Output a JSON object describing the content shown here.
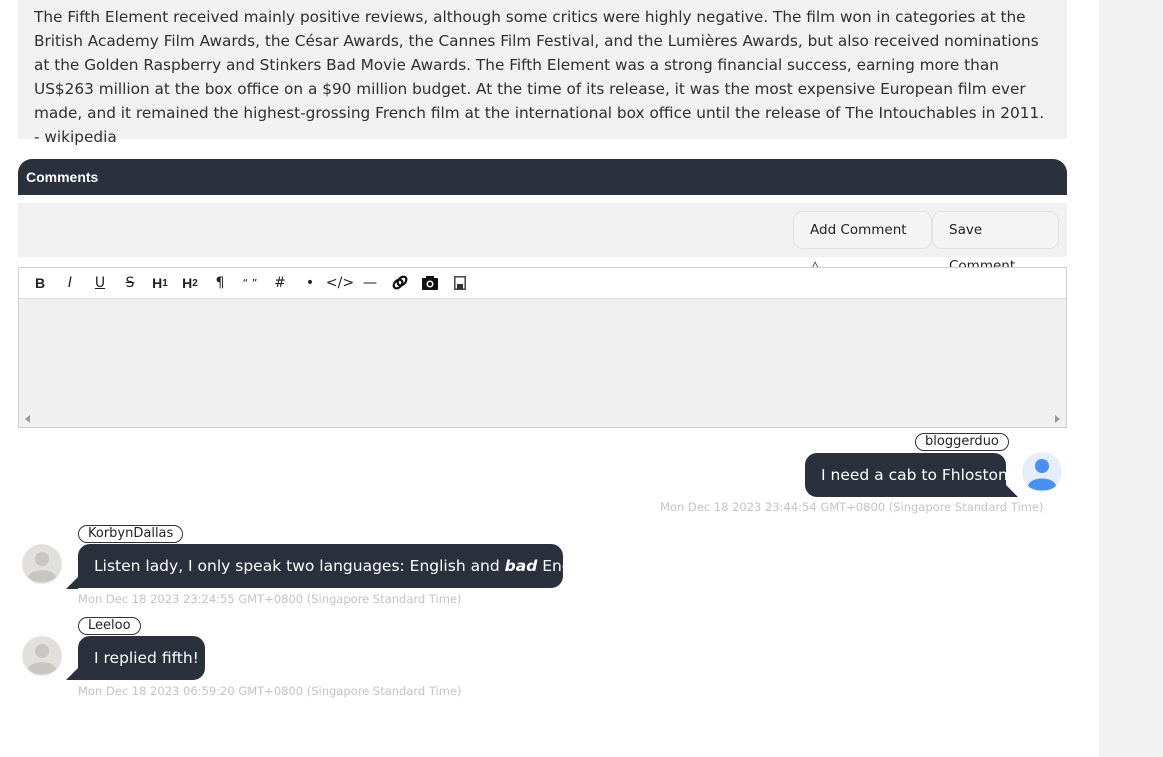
{
  "article": {
    "text": "The Fifth Element received mainly positive reviews, although some critics were highly negative. The film won in categories at the British Academy Film Awards, the César Awards, the Cannes Film Festival, and the Lumières Awards, but also received nominations at the Golden Raspberry and Stinkers Bad Movie Awards. The Fifth Element was a strong financial success, earning more than US$263 million at the box office on a $90 million budget. At the time of its release, it was the most expensive European film ever made, and it remained the highest-grossing French film at the international box office until the release of The Intouchables in 2011. - wikipedia"
  },
  "comments": {
    "title": "Comments",
    "add_label": "Add Comment △",
    "save_label": "Save Comment"
  },
  "editor": {
    "tools": [
      {
        "name": "bold-icon",
        "glyph": "B"
      },
      {
        "name": "italic-icon",
        "glyph": "I"
      },
      {
        "name": "underline-icon",
        "glyph": "U"
      },
      {
        "name": "strikethrough-icon",
        "glyph": "S"
      },
      {
        "name": "heading1-icon",
        "glyph": "H1"
      },
      {
        "name": "heading2-icon",
        "glyph": "H2"
      },
      {
        "name": "paragraph-icon",
        "glyph": "¶"
      },
      {
        "name": "quote-icon",
        "glyph": "“ ”"
      },
      {
        "name": "hash-icon",
        "glyph": "#"
      },
      {
        "name": "bullet-icon",
        "glyph": "•"
      },
      {
        "name": "code-icon",
        "glyph": "</>"
      },
      {
        "name": "horizontal-rule-icon",
        "glyph": "—"
      },
      {
        "name": "link-icon",
        "glyph": ""
      },
      {
        "name": "camera-icon",
        "glyph": ""
      },
      {
        "name": "save-icon",
        "glyph": ""
      }
    ]
  },
  "messages": [
    {
      "user": "bloggerduo",
      "text": "I need a cab to Fhloston",
      "time": "Mon Dec 18 2023 23:44:54 GMT+0800 (Singapore Standard Time)",
      "side": "right"
    },
    {
      "user": "KorbynDallas",
      "text_before": "Listen lady, I only speak two languages: English and ",
      "text_em": "bad",
      "text_after": " English.",
      "time": "Mon Dec 18 2023 23:24:55 GMT+0800 (Singapore Standard Time)",
      "side": "left"
    },
    {
      "user": "Leeloo",
      "text": "I replied fifth!",
      "time": "Mon Dec 18 2023 06:59:20 GMT+0800 (Singapore Standard Time)",
      "side": "left"
    }
  ],
  "colors": {
    "header_bg": "#2a313d",
    "panel_bg": "#f1f1f1",
    "own_avatar": "#4a90f0",
    "other_avatar": "#c8c6c1"
  }
}
